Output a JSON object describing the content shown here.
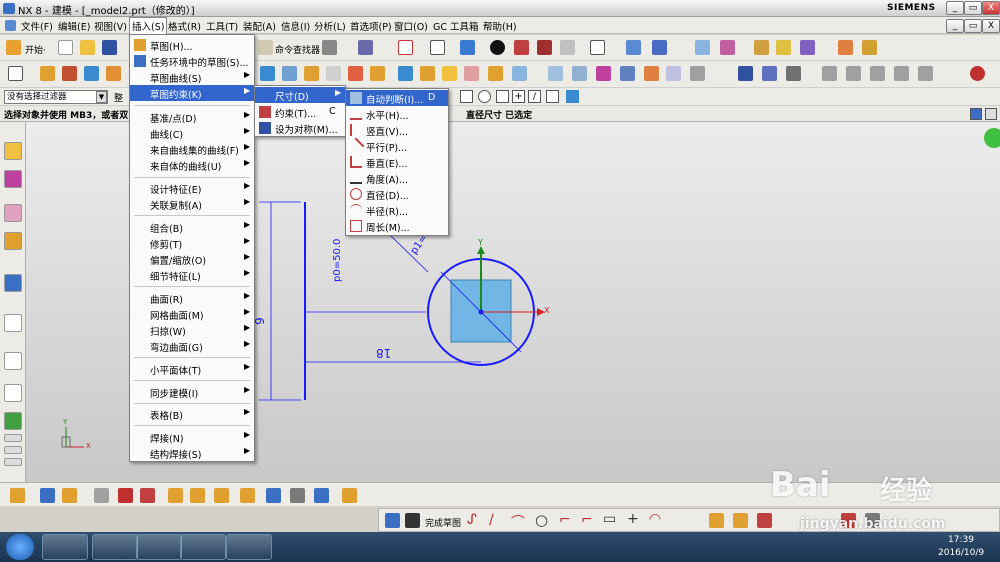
{
  "window": {
    "title": "NX 8 - 建模 - [_model2.prt（修改的）]",
    "brand": "SIEMENS",
    "controls": [
      "_",
      "▭",
      "X"
    ],
    "inner_controls": [
      "_",
      "▭",
      "X"
    ]
  },
  "menubar": {
    "items": [
      "文件(F)",
      "编辑(E)",
      "视图(V)",
      "插入(S)",
      "格式(R)",
      "工具(T)",
      "装配(A)",
      "信息(I)",
      "分析(L)",
      "首选项(P)",
      "窗口(O)",
      "GC 工具箱",
      "帮助(H)"
    ]
  },
  "toolbar": {
    "start_label": "开始·",
    "command_finder": "命令查找器"
  },
  "filter": {
    "value": "没有选择过滤器",
    "second": "整"
  },
  "status": {
    "message": "选择对象并使用 MB3，或者双",
    "right": "直径尺寸 已选定"
  },
  "insert_menu": {
    "items": [
      {
        "label": "草图(H)...",
        "arrow": ""
      },
      {
        "label": "任务环境中的草图(S)...",
        "arrow": ""
      },
      {
        "label": "草图曲线(S)",
        "arrow": "▶"
      },
      {
        "label": "草图约束(K)",
        "arrow": "▶"
      },
      {
        "label": "基准/点(D)",
        "arrow": "▶"
      },
      {
        "label": "曲线(C)",
        "arrow": "▶"
      },
      {
        "label": "来自曲线集的曲线(F)",
        "arrow": "▶"
      },
      {
        "label": "来自体的曲线(U)",
        "arrow": "▶"
      },
      {
        "label": "设计特征(E)",
        "arrow": "▶"
      },
      {
        "label": "关联复制(A)",
        "arrow": "▶"
      },
      {
        "label": "组合(B)",
        "arrow": "▶"
      },
      {
        "label": "修剪(T)",
        "arrow": "▶"
      },
      {
        "label": "偏置/缩放(O)",
        "arrow": "▶"
      },
      {
        "label": "细节特征(L)",
        "arrow": "▶"
      },
      {
        "label": "曲面(R)",
        "arrow": "▶"
      },
      {
        "label": "网格曲面(M)",
        "arrow": "▶"
      },
      {
        "label": "扫掠(W)",
        "arrow": "▶"
      },
      {
        "label": "弯边曲面(G)",
        "arrow": "▶"
      },
      {
        "label": "小平面体(T)",
        "arrow": "▶"
      },
      {
        "label": "同步建模(I)",
        "arrow": "▶"
      },
      {
        "label": "表格(B)",
        "arrow": "▶"
      },
      {
        "label": "焊接(N)",
        "arrow": "▶"
      },
      {
        "label": "结构焊接(S)",
        "arrow": "▶"
      }
    ]
  },
  "constraint_menu": {
    "items": [
      {
        "label": "尺寸(D)",
        "arrow": "▶",
        "shortcut": ""
      },
      {
        "label": "约束(T)...",
        "arrow": "",
        "shortcut": "C"
      },
      {
        "label": "设为对称(M)...",
        "arrow": "",
        "shortcut": ""
      }
    ]
  },
  "dimension_menu": {
    "items": [
      {
        "label": "自动判断(I)...",
        "shortcut": "D"
      },
      {
        "label": "水平(H)...",
        "shortcut": ""
      },
      {
        "label": "竖直(V)...",
        "shortcut": ""
      },
      {
        "label": "平行(P)...",
        "shortcut": ""
      },
      {
        "label": "垂直(E)...",
        "shortcut": ""
      },
      {
        "label": "角度(A)...",
        "shortcut": ""
      },
      {
        "label": "直径(D)...",
        "shortcut": ""
      },
      {
        "label": "半径(R)...",
        "shortcut": ""
      },
      {
        "label": "周长(M)...",
        "shortcut": ""
      }
    ]
  },
  "sketch": {
    "dim_p0": "p0=50.0",
    "dim_p1": "p1=50.0",
    "dim_9": "9",
    "dim_18": "18",
    "axis_x": "X",
    "axis_y": "Y"
  },
  "bottom": {
    "finish_sketch": "完成草图"
  },
  "taskbar": {
    "time": "17:39",
    "date": "2016/10/9"
  },
  "watermark": {
    "brand": "Bai",
    "brand_cn": "经验",
    "url": "jingyan.baidu.com"
  },
  "colors": {
    "menu_highlight": "#3366cc",
    "sketch_blue": "#1a1aff",
    "body_blue": "#66b3e6",
    "axis_green": "#1a8a1a",
    "axis_red": "#d42020"
  }
}
